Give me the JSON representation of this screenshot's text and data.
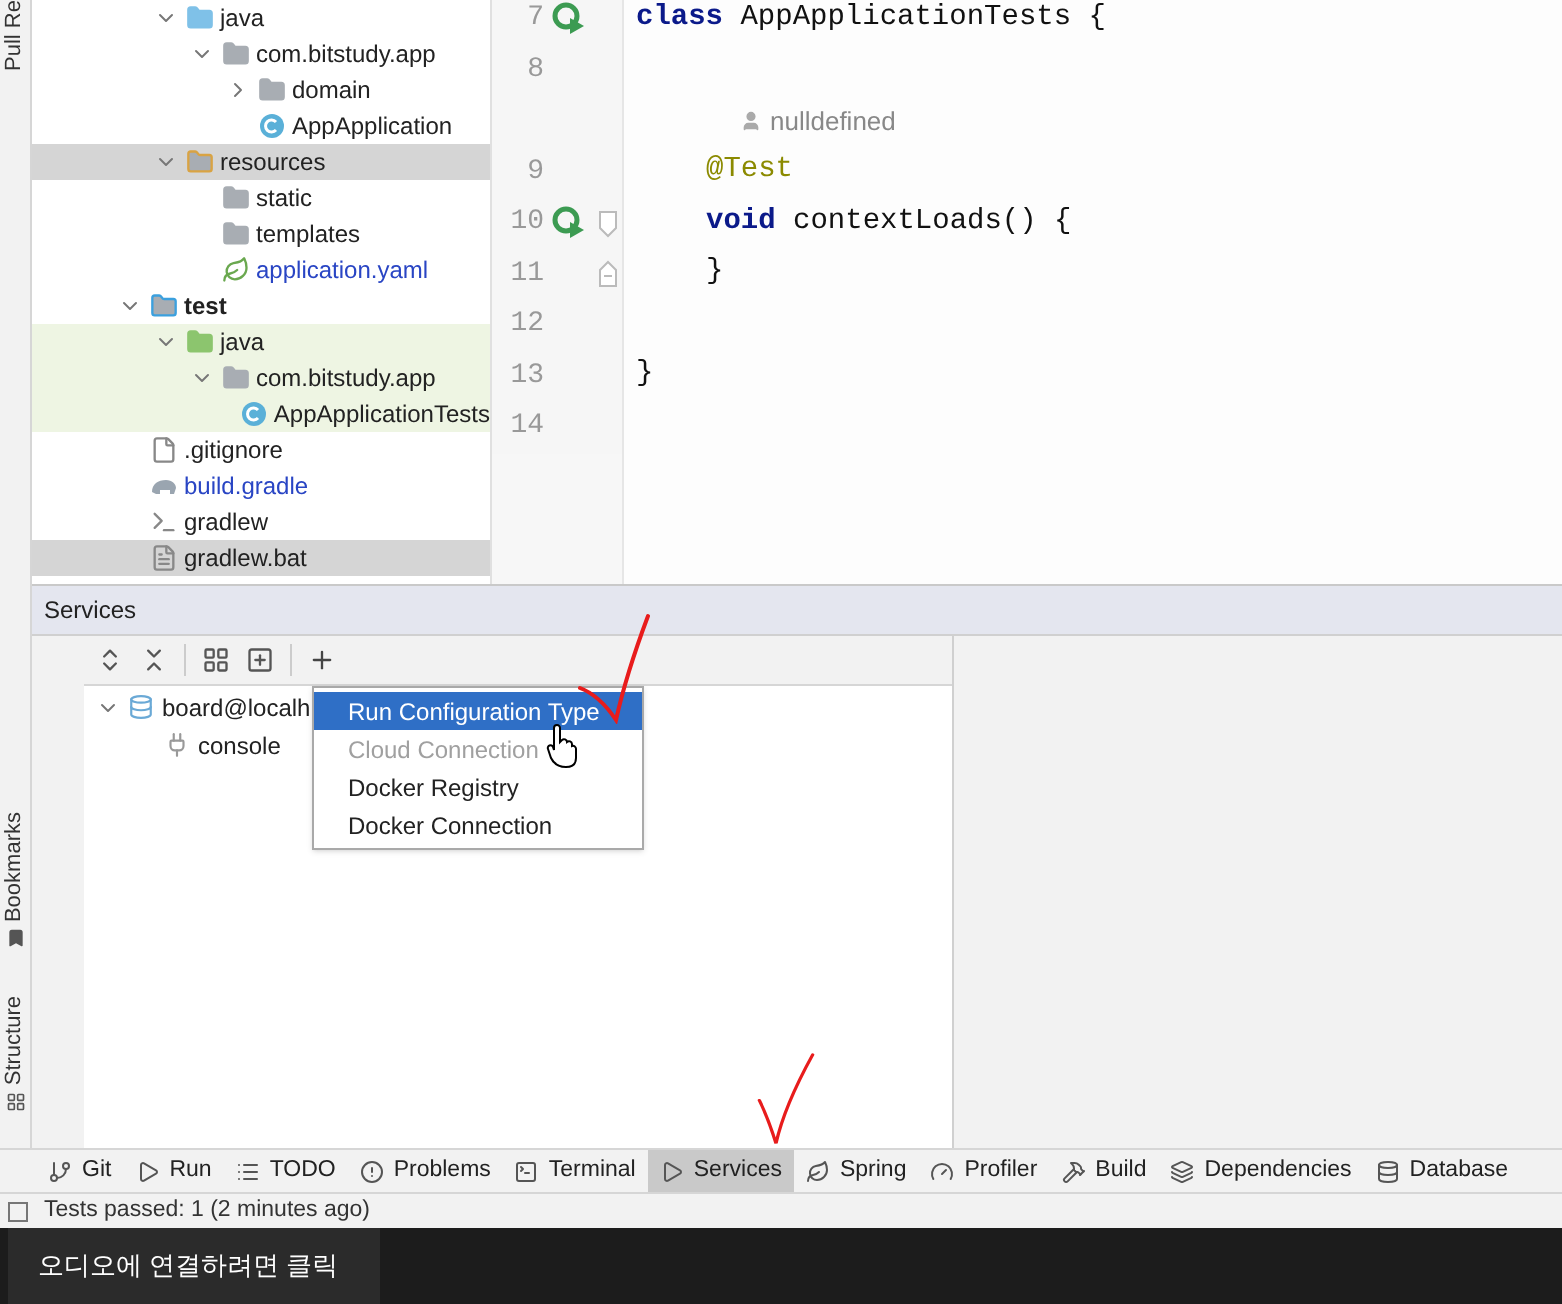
{
  "side_strip": [
    {
      "label": "Pull Re"
    },
    {
      "label": "Bookmarks"
    },
    {
      "label": "Structure"
    }
  ],
  "project_tree": {
    "main_children": [
      {
        "label": "java",
        "kind": "source_folder",
        "expanded": true,
        "selected": false,
        "tinted": false,
        "modified": false,
        "children": [
          {
            "label": "com.bitstudy.app",
            "kind": "package",
            "expanded": true,
            "selected": false,
            "tinted": false,
            "modified": false,
            "children": [
              {
                "label": "domain",
                "kind": "package",
                "expanded": false,
                "selected": false,
                "tinted": false,
                "modified": false
              },
              {
                "label": "AppApplication",
                "kind": "spring_class",
                "selected": false,
                "tinted": false,
                "modified": false
              }
            ]
          }
        ]
      },
      {
        "label": "resources",
        "kind": "resources_folder",
        "expanded": true,
        "selected": true,
        "tinted": false,
        "modified": false,
        "children": [
          {
            "label": "static",
            "kind": "folder",
            "selected": false,
            "tinted": false,
            "modified": false
          },
          {
            "label": "templates",
            "kind": "folder",
            "selected": false,
            "tinted": false,
            "modified": false
          },
          {
            "label": "application.yaml",
            "kind": "yaml",
            "selected": false,
            "tinted": false,
            "modified": true
          }
        ]
      }
    ],
    "items": [
      {
        "label": "test",
        "kind": "test_root",
        "expanded": true,
        "selected": false,
        "tinted": false,
        "modified": false,
        "children": [
          {
            "label": "java",
            "kind": "test_folder",
            "expanded": true,
            "selected": false,
            "tinted": true,
            "modified": false,
            "children": [
              {
                "label": "com.bitstudy.app",
                "kind": "package",
                "expanded": true,
                "selected": false,
                "tinted": true,
                "modified": false,
                "children": [
                  {
                    "label": "AppApplicationTests",
                    "kind": "test_class",
                    "selected": false,
                    "tinted": true,
                    "modified": false
                  }
                ]
              }
            ]
          }
        ]
      },
      {
        "label": ".gitignore",
        "kind": "ignore",
        "selected": false,
        "tinted": false,
        "modified": false
      },
      {
        "label": "build.gradle",
        "kind": "gradle",
        "selected": false,
        "tinted": false,
        "modified": true
      },
      {
        "label": "gradlew",
        "kind": "script",
        "selected": false,
        "tinted": false,
        "modified": false
      },
      {
        "label": "gradlew.bat",
        "kind": "text",
        "selected": true,
        "tinted": false,
        "modified": false
      }
    ]
  },
  "editor": {
    "lines": [
      {
        "kind": "code",
        "number": "7",
        "run_icon": true,
        "fold_start": false,
        "fold_end": false,
        "tokens": [
          {
            "kind": "keyword",
            "text": "class"
          },
          {
            "kind": "plain",
            "text": " AppApplicationTests {"
          }
        ]
      },
      {
        "kind": "code",
        "number": "8",
        "run_icon": false,
        "fold_start": false,
        "fold_end": false
      },
      {
        "kind": "inlay",
        "text": "nulldefined"
      },
      {
        "kind": "indented",
        "number": "9",
        "run_icon": false,
        "fold_start": false,
        "fold_end": false,
        "tokens": [
          {
            "kind": "annotation",
            "text": "@Test"
          }
        ]
      },
      {
        "kind": "indented",
        "number": "10",
        "run_icon": true,
        "fold_start": true,
        "fold_end": false,
        "tokens": [
          {
            "kind": "keyword",
            "text": "void"
          },
          {
            "kind": "plain",
            "text": " contextLoads() {"
          }
        ]
      },
      {
        "kind": "indented",
        "number": "11",
        "run_icon": false,
        "fold_start": false,
        "fold_end": true,
        "tokens": [
          {
            "kind": "plain",
            "text": "}"
          }
        ]
      },
      {
        "kind": "code",
        "number": "12",
        "run_icon": false,
        "fold_start": false,
        "fold_end": false
      },
      {
        "kind": "code",
        "number": "13",
        "run_icon": false,
        "fold_start": false,
        "fold_end": false,
        "tokens": [
          {
            "kind": "plain",
            "text": "}"
          }
        ]
      },
      {
        "kind": "code",
        "number": "14",
        "run_icon": false,
        "fold_start": false,
        "fold_end": false
      }
    ]
  },
  "services": {
    "title": "Services",
    "tree": [
      {
        "label": "board@localh",
        "expanded": true,
        "children": [
          {
            "label": "console"
          }
        ]
      }
    ],
    "add_menu": [
      {
        "label": "Run Configuration Type",
        "selected": true,
        "disabled": false
      },
      {
        "label": "Cloud Connection",
        "selected": false,
        "disabled": true
      },
      {
        "label": "Docker Registry",
        "selected": false,
        "disabled": false
      },
      {
        "label": "Docker Connection",
        "selected": false,
        "disabled": false
      }
    ]
  },
  "tool_tabs": [
    {
      "label": "Git",
      "kind": "git",
      "selected": false
    },
    {
      "label": "Run",
      "kind": "run",
      "selected": false
    },
    {
      "label": "TODO",
      "kind": "todo",
      "selected": false
    },
    {
      "label": "Problems",
      "kind": "problems",
      "selected": false
    },
    {
      "label": "Terminal",
      "kind": "terminal",
      "selected": false
    },
    {
      "label": "Services",
      "kind": "services",
      "selected": true
    },
    {
      "label": "Spring",
      "kind": "spring",
      "selected": false
    },
    {
      "label": "Profiler",
      "kind": "profiler",
      "selected": false
    },
    {
      "label": "Build",
      "kind": "build",
      "selected": false
    },
    {
      "label": "Dependencies",
      "kind": "dependencies",
      "selected": false
    },
    {
      "label": "Database",
      "kind": "database",
      "selected": false
    }
  ],
  "status_bar": {
    "text": "Tests passed: 1 (2 minutes ago)"
  },
  "audio_tooltip": {
    "text": "오디오에 연결하려면 클릭"
  }
}
